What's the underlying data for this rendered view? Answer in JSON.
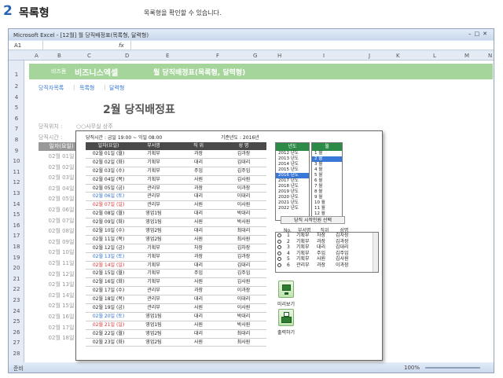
{
  "section": {
    "number": "2",
    "title": "목록형",
    "desc": "목록형을 확인할 수 있습니다."
  },
  "excel": {
    "title": "Microsoft Excel - [12월] 월 당직배정표(목록형, 달력형)",
    "cell_ref": "A1",
    "fx": "fx",
    "columns": [
      "A",
      "B",
      "C",
      "D",
      "E",
      "F",
      "G",
      "H",
      "I",
      "J",
      "K",
      "L",
      "M",
      "N"
    ],
    "rows": [
      "1",
      "2",
      "4",
      "5",
      "6",
      "7",
      "8",
      "9",
      "10",
      "11",
      "12",
      "13",
      "14",
      "15",
      "16",
      "17",
      "18",
      "19",
      "20",
      "21",
      "22",
      "23",
      "24",
      "25",
      "26",
      "27",
      "28",
      "29"
    ],
    "brand_small": "비즈폼",
    "brand": "비즈니스엑셀",
    "header_title": "월 당직배정표(목록형, 달력형)",
    "nav": [
      "당직자목록",
      "목록형",
      "달력형"
    ],
    "page_title": "2월 당직배정표",
    "label_place": "당직위치 :",
    "label_place_val": "○○사무실 상주",
    "label_time": "당직시간 :",
    "side_header": "일자(요일)",
    "side_dates": [
      "02월 01일",
      "02월 02일",
      "02월 03일",
      "02월 04일",
      "02월 05일",
      "02월 06일",
      "02월 07일",
      "02월 08일",
      "02월 09일",
      "02월 10일",
      "02월 11일",
      "02월 12일",
      "02월 13일",
      "02월 14일",
      "02월 15일",
      "02월 16일",
      "02월 17일",
      "02월 18일"
    ],
    "status_left": "준비",
    "zoom": "100%"
  },
  "popup": {
    "time_label": "당직시간 :  금일 19:00 ~ 익일 08:00",
    "base_year": "기준년도 : 2016년",
    "headers": [
      "일자(요일)",
      "부서명",
      "직 위",
      "성 명"
    ],
    "rows": [
      [
        "02월 01일 (월)",
        "기획부",
        "과장",
        "김과장",
        ""
      ],
      [
        "02월 02일 (화)",
        "기획부",
        "대리",
        "김대리",
        ""
      ],
      [
        "02월 03일 (수)",
        "기획부",
        "주임",
        "김주임",
        ""
      ],
      [
        "02월 04일 (목)",
        "기획부",
        "사원",
        "김사원",
        ""
      ],
      [
        "02월 05일 (금)",
        "관리부",
        "과장",
        "이과장",
        ""
      ],
      [
        "02월 06일 (토)",
        "관리부",
        "대리",
        "이대리",
        "blue"
      ],
      [
        "02월 07일 (일)",
        "관리부",
        "사원",
        "이사원",
        "red"
      ],
      [
        "02월 08일 (월)",
        "영업1팀",
        "대리",
        "박대리",
        ""
      ],
      [
        "02월 09일 (화)",
        "영업1팀",
        "사원",
        "박사원",
        ""
      ],
      [
        "02월 10일 (수)",
        "영업2팀",
        "대리",
        "최대리",
        ""
      ],
      [
        "02월 11일 (목)",
        "영업2팀",
        "사원",
        "최사원",
        ""
      ],
      [
        "02월 12일 (금)",
        "기획부",
        "차장",
        "김차장",
        ""
      ],
      [
        "02월 13일 (토)",
        "기획부",
        "과장",
        "김과장",
        "blue"
      ],
      [
        "02월 14일 (일)",
        "기획부",
        "대리",
        "김대리",
        "red"
      ],
      [
        "02월 15일 (월)",
        "기획부",
        "주임",
        "김주임",
        ""
      ],
      [
        "02월 16일 (화)",
        "기획부",
        "사원",
        "김사원",
        ""
      ],
      [
        "02월 17일 (수)",
        "관리부",
        "과장",
        "이과장",
        ""
      ],
      [
        "02월 18일 (목)",
        "관리부",
        "대리",
        "이대리",
        ""
      ],
      [
        "02월 19일 (금)",
        "관리부",
        "사원",
        "이사원",
        ""
      ],
      [
        "02월 20일 (토)",
        "영업1팀",
        "대리",
        "박대리",
        "blue"
      ],
      [
        "02월 21일 (일)",
        "영업1팀",
        "사원",
        "박사원",
        "red"
      ],
      [
        "02월 22일 (월)",
        "영업2팀",
        "대리",
        "최대리",
        ""
      ],
      [
        "02월 23일 (화)",
        "영업2팀",
        "사원",
        "최사원",
        ""
      ]
    ],
    "year_header": "년도",
    "years": [
      "2012 년도",
      "2013 년도",
      "2014 년도",
      "2015 년도",
      "2016 년도",
      "2017 년도",
      "2018 년도",
      "2019 년도",
      "2020 년도",
      "2021 년도",
      "2022 년도"
    ],
    "year_selected": 4,
    "month_header": "월",
    "months": [
      "1 월",
      "2 월",
      "3 월",
      "4 월",
      "5 월",
      "6 월",
      "7 월",
      "8 월",
      "9 월",
      "10 월",
      "11 월",
      "12 월"
    ],
    "month_selected": 1,
    "start_person_title": "당직 시작인원 선택",
    "emp_headers": [
      "No.",
      "부서명",
      "직위",
      "성명"
    ],
    "employees": [
      [
        "1",
        "기획부",
        "차장",
        "김차장"
      ],
      [
        "2",
        "기획부",
        "과장",
        "김과장"
      ],
      [
        "3",
        "기획부",
        "대리",
        "김대리"
      ],
      [
        "4",
        "기획부",
        "주임",
        "김주임"
      ],
      [
        "5",
        "기획부",
        "사원",
        "김사원"
      ],
      [
        "6",
        "관리부",
        "과장",
        "이과장"
      ]
    ],
    "preview_label": "미리보기",
    "print_label": "출력하기"
  }
}
